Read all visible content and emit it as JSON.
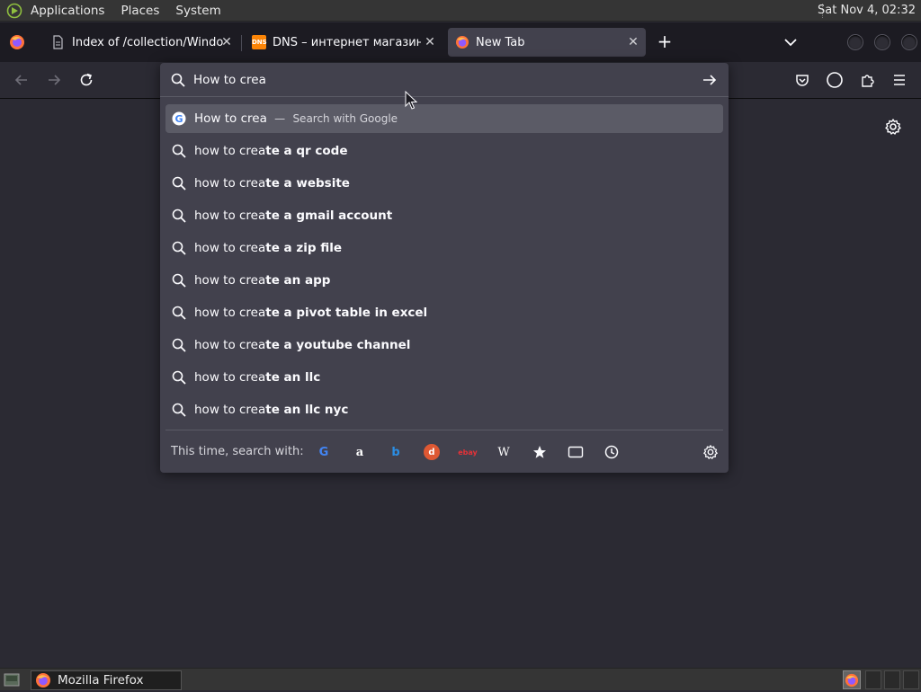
{
  "top_panel": {
    "menus": [
      "Applications",
      "Places",
      "System"
    ],
    "clock": "Sat Nov  4, 02:32"
  },
  "tabs": [
    {
      "title": "Index of /collection/Window",
      "icon": "file-icon"
    },
    {
      "title": "DNS – интернет магазин ц",
      "icon": "dns-favicon",
      "favicon_text": "DNS"
    },
    {
      "title": "New Tab",
      "icon": "firefox-icon"
    }
  ],
  "urlbar": {
    "value": "How to crea"
  },
  "suggestions": {
    "heuristic": {
      "text": "How to crea",
      "separator": "—",
      "action": "Search with Google"
    },
    "items": [
      {
        "prefix": "how to crea",
        "bold": "te a qr code"
      },
      {
        "prefix": "how to crea",
        "bold": "te a website"
      },
      {
        "prefix": "how to crea",
        "bold": "te a gmail account"
      },
      {
        "prefix": "how to crea",
        "bold": "te a zip file"
      },
      {
        "prefix": "how to crea",
        "bold": "te an app"
      },
      {
        "prefix": "how to crea",
        "bold": "te a pivot table in excel"
      },
      {
        "prefix": "how to crea",
        "bold": "te a youtube channel"
      },
      {
        "prefix": "how to crea",
        "bold": "te an llc"
      },
      {
        "prefix": "how to crea",
        "bold": "te an llc nyc"
      }
    ]
  },
  "oneoff": {
    "label": "This time, search with:",
    "engines": [
      {
        "name": "google",
        "glyph": "G",
        "color": "#4285f4"
      },
      {
        "name": "amazon",
        "glyph": "a",
        "color": "#ffffff"
      },
      {
        "name": "bing",
        "glyph": "b",
        "color": "#2b8de3"
      },
      {
        "name": "duckduckgo",
        "glyph": "d",
        "color": "#de5833"
      },
      {
        "name": "ebay",
        "glyph": "ebay",
        "color": "#e53238"
      },
      {
        "name": "wikipedia",
        "glyph": "W",
        "color": "#ffffff"
      }
    ]
  },
  "taskbar": {
    "task_label": "Mozilla Firefox"
  },
  "colors": {
    "accent": "#5b5b66",
    "background": "#2b2a33",
    "popup": "#42414d"
  }
}
